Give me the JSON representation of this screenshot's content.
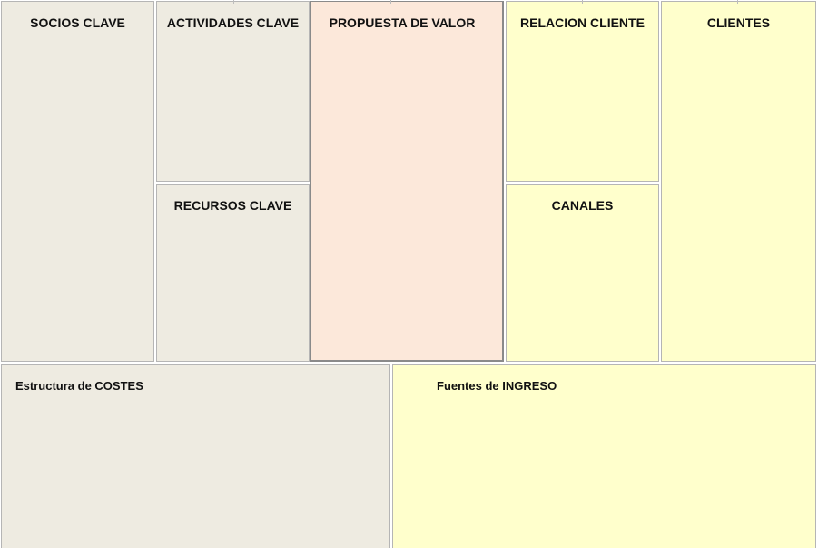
{
  "canvas": {
    "socios": {
      "label": "SOCIOS CLAVE"
    },
    "actividades": {
      "label": "ACTIVIDADES CLAVE"
    },
    "recursos": {
      "label": "RECURSOS CLAVE"
    },
    "propuesta": {
      "label": "PROPUESTA DE VALOR"
    },
    "relacion": {
      "label": "RELACION CLIENTE"
    },
    "canales": {
      "label": "CANALES"
    },
    "clientes": {
      "label": "CLIENTES"
    },
    "costes": {
      "label": "Estructura de COSTES"
    },
    "ingresos": {
      "label": "Fuentes de INGRESO"
    }
  },
  "colors": {
    "grey": "#eeebe1",
    "pink": "#fce8da",
    "yellow": "#ffffcc"
  }
}
